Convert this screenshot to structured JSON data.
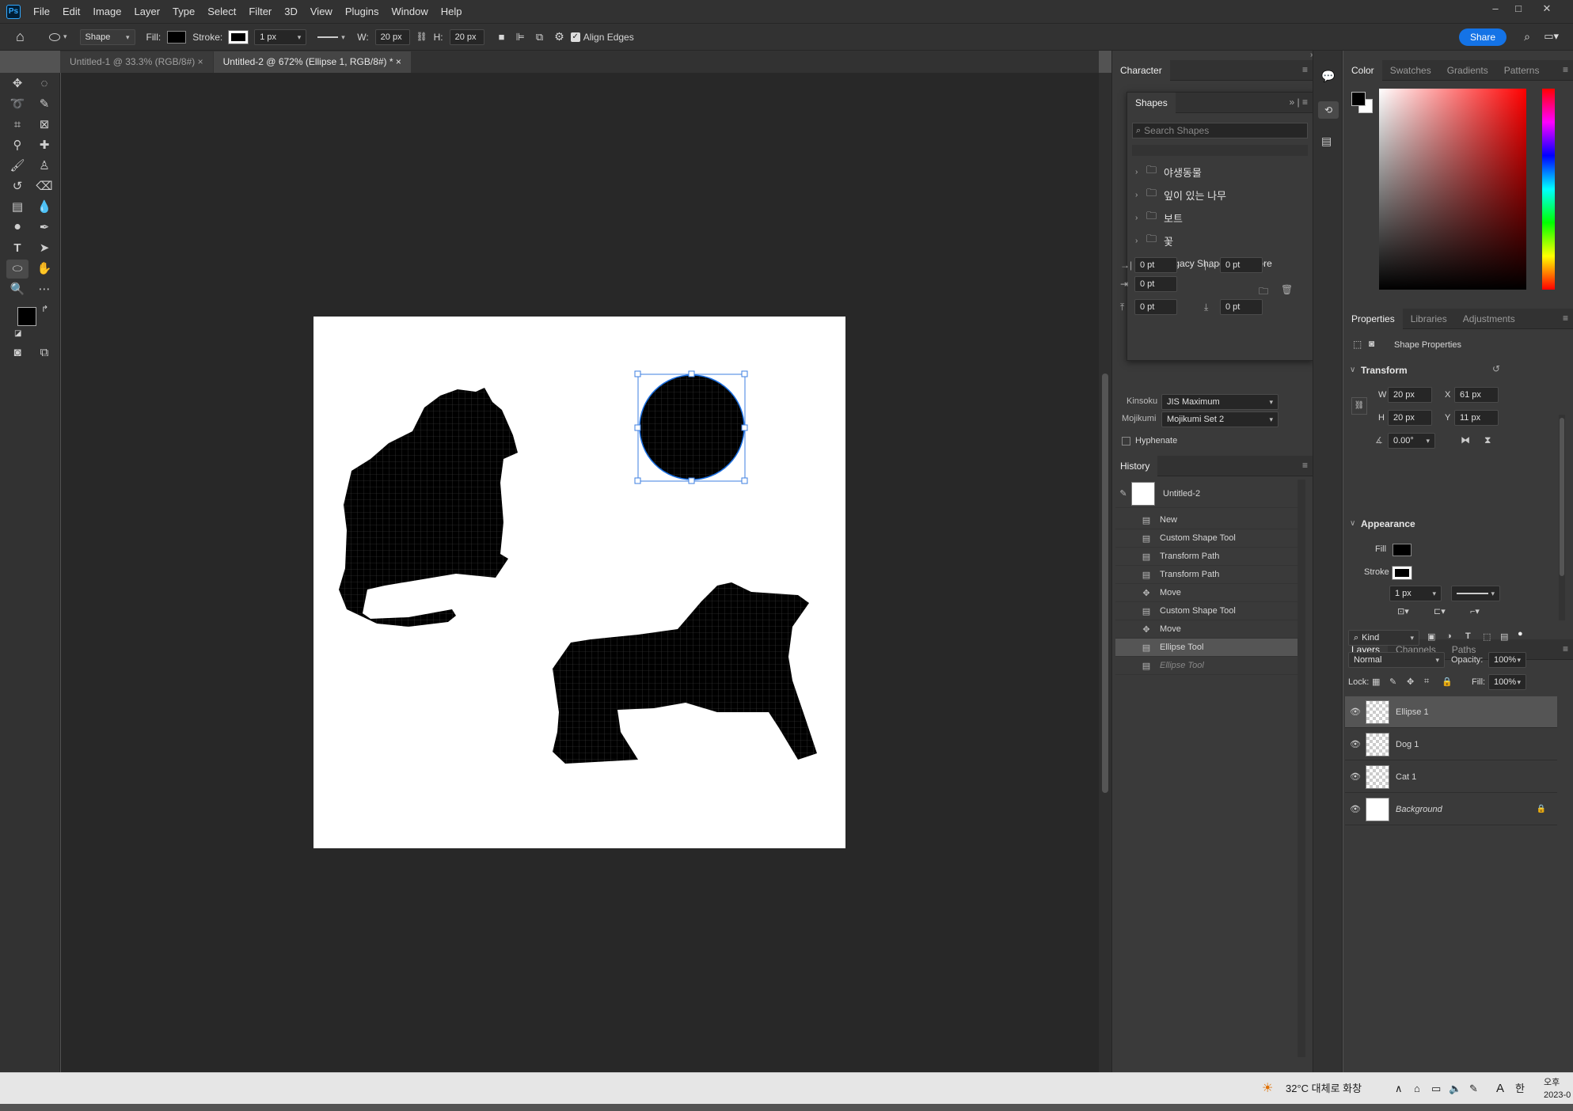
{
  "menubar": {
    "logo": "Ps",
    "items": [
      "File",
      "Edit",
      "Image",
      "Layer",
      "Type",
      "Select",
      "Filter",
      "3D",
      "View",
      "Plugins",
      "Window",
      "Help"
    ]
  },
  "options": {
    "mode": "Shape",
    "fill_label": "Fill:",
    "stroke_label": "Stroke:",
    "stroke_width": "1 px",
    "w_label": "W:",
    "w_value": "20 px",
    "h_label": "H:",
    "h_value": "20 px",
    "align_edges": "Align Edges",
    "share": "Share"
  },
  "tabs": [
    {
      "label": "Untitled-1 @ 33.3% (RGB/8#)",
      "active": false
    },
    {
      "label": "Untitled-2 @ 672% (Ellipse 1, RGB/8#) *",
      "active": true
    }
  ],
  "character_panel": {
    "title": "Character",
    "fields": [
      "0 pt",
      "0 pt",
      "0 pt",
      "0 pt",
      "0 pt",
      "0 pt"
    ],
    "kinsoku_label": "Kinsoku",
    "kinsoku_value": "JIS Maximum",
    "mojikumi_label": "Mojikumi",
    "mojikumi_value": "Mojikumi Set 2",
    "hyphenate": "Hyphenate"
  },
  "shapes_panel": {
    "title": "Shapes",
    "search_placeholder": "Search Shapes",
    "groups": [
      "야생동물",
      "잎이 있는 나무",
      "보트",
      "꽃",
      "Legacy Shapes and More"
    ]
  },
  "history_panel": {
    "title": "History",
    "snapshot": "Untitled-2",
    "items": [
      {
        "label": "New",
        "icon": "doc-icon",
        "state": "normal"
      },
      {
        "label": "Custom Shape Tool",
        "icon": "doc-icon",
        "state": "normal"
      },
      {
        "label": "Transform Path",
        "icon": "doc-icon",
        "state": "normal"
      },
      {
        "label": "Transform Path",
        "icon": "doc-icon",
        "state": "normal"
      },
      {
        "label": "Move",
        "icon": "move-icon",
        "state": "normal"
      },
      {
        "label": "Custom Shape Tool",
        "icon": "doc-icon",
        "state": "normal"
      },
      {
        "label": "Move",
        "icon": "move-icon",
        "state": "normal"
      },
      {
        "label": "Ellipse Tool",
        "icon": "doc-icon",
        "state": "selected"
      },
      {
        "label": "Ellipse Tool",
        "icon": "doc-icon",
        "state": "ghost"
      }
    ]
  },
  "color_panel": {
    "tabs": [
      "Color",
      "Swatches",
      "Gradients",
      "Patterns"
    ],
    "hue_color": "#ff0000"
  },
  "properties_panel": {
    "tabs": [
      "Properties",
      "Libraries",
      "Adjustments"
    ],
    "subtitle": "Shape Properties",
    "transform_title": "Transform",
    "w_label": "W",
    "w": "20 px",
    "x_label": "X",
    "x": "61 px",
    "h_label": "H",
    "h": "20 px",
    "y_label": "Y",
    "y": "11 px",
    "angle": "0.00°",
    "appearance_title": "Appearance",
    "fill_label": "Fill",
    "stroke_label": "Stroke",
    "stroke_width": "1 px"
  },
  "layers_panel": {
    "tabs": [
      "Layers",
      "Channels",
      "Paths"
    ],
    "kind": "Kind",
    "blend_mode": "Normal",
    "opacity_label": "Opacity:",
    "opacity": "100%",
    "lock_label": "Lock:",
    "fill_label": "Fill:",
    "fill": "100%",
    "layers": [
      {
        "name": "Ellipse 1",
        "selected": true,
        "thumb": "shape"
      },
      {
        "name": "Dog 1",
        "selected": false,
        "thumb": "shape"
      },
      {
        "name": "Cat 1",
        "selected": false,
        "thumb": "shape"
      },
      {
        "name": "Background",
        "selected": false,
        "thumb": "white"
      }
    ]
  },
  "taskbar": {
    "weather": "32°C 대체로 화창",
    "ime": "한",
    "clock_top": "오후",
    "clock_bottom": "2023-0"
  }
}
